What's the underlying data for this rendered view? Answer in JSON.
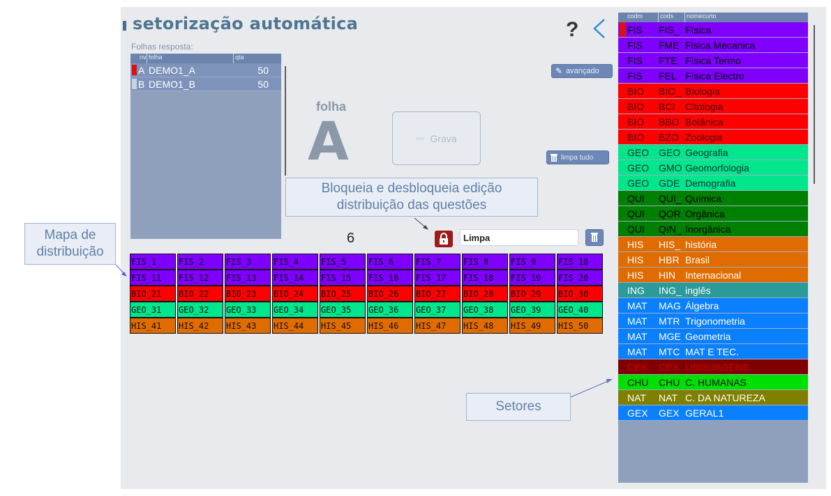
{
  "header": {
    "title": "setorização automática",
    "help_label": "?"
  },
  "folhas": {
    "label": "Folhas resposta:",
    "columns": [
      "nv",
      "folha",
      "qta"
    ],
    "rows": [
      {
        "nv": "A",
        "folha": "DEMO1_A",
        "qta": "50",
        "selected": true
      },
      {
        "nv": "B",
        "folha": "DEMO1_B",
        "qta": "50",
        "selected": false
      }
    ]
  },
  "folha_display": {
    "label": "folha",
    "letter": "A"
  },
  "actions": {
    "grava_label": "Grava",
    "avancado_label": "avançado",
    "limpa_tudo_label": "limpa tudo"
  },
  "callouts": {
    "bloqueia": "Bloqueia e desbloqueia edição distribuição das questões",
    "mapa": "Mapa de distribuição",
    "setores": "Setores"
  },
  "toolbar": {
    "count": "6",
    "limpa_value": "Limpa"
  },
  "colors": {
    "FIS": "#8000ff",
    "BIO": "#ff0000",
    "GEO": "#00e68c",
    "QUI": "#008000",
    "HIS": "#e06c00",
    "ING": "#2a9a9a",
    "MAT": "#0a80ff",
    "CEX": "#800000",
    "CHU": "#00e000",
    "NAT": "#808000",
    "GEX": "#0a80ff"
  },
  "distribution": [
    [
      "FIS_1",
      "FIS_2",
      "FIS_3",
      "FIS_4",
      "FIS_5",
      "FIS_6",
      "FIS_7",
      "FIS_8",
      "FIS_9",
      "FIS_10"
    ],
    [
      "FIS_11",
      "FIS_12",
      "FIS_13",
      "FIS_14",
      "FIS_15",
      "FIS_16",
      "FIS_17",
      "FIS_18",
      "FIS_19",
      "FIS_20"
    ],
    [
      "BIO_21",
      "BIO_22",
      "BIO_23",
      "BIO_24",
      "BIO_25",
      "BIO_26",
      "BIO_27",
      "BIO_28",
      "BIO_29",
      "BIO_30"
    ],
    [
      "GEO_31",
      "GEO_32",
      "GEO_33",
      "GEO_34",
      "GEO_35",
      "GEO_36",
      "GEO_37",
      "GEO_38",
      "GEO_39",
      "GEO_40"
    ],
    [
      "HIS_41",
      "HIS_42",
      "HIS_43",
      "HIS_44",
      "HIS_45",
      "HIS_46",
      "HIS_47",
      "HIS_48",
      "HIS_49",
      "HIS_50"
    ]
  ],
  "setores": {
    "columns": [
      "codm",
      "cods",
      "nomecurto"
    ],
    "rows": [
      {
        "codm": "FIS",
        "cods": "FIS_",
        "nome": "Física",
        "selected": true
      },
      {
        "codm": "FIS",
        "cods": "FME",
        "nome": "Fisica Mecanica"
      },
      {
        "codm": "FIS",
        "cods": "FTE",
        "nome": "Física Termo"
      },
      {
        "codm": "FIS",
        "cods": "FEL",
        "nome": "Física Electro"
      },
      {
        "codm": "BIO",
        "cods": "BIO_",
        "nome": "Biologia"
      },
      {
        "codm": "BIO",
        "cods": "BCI",
        "nome": "Citologia"
      },
      {
        "codm": "BIO",
        "cods": "BBO",
        "nome": "Botânica"
      },
      {
        "codm": "BIO",
        "cods": "BZO",
        "nome": "Zoologia"
      },
      {
        "codm": "GEO",
        "cods": "GEO",
        "nome": "Geografia"
      },
      {
        "codm": "GEO",
        "cods": "GMO",
        "nome": "Geomorfologia"
      },
      {
        "codm": "GEO",
        "cods": "GDE",
        "nome": "Demografia"
      },
      {
        "codm": "QUI",
        "cods": "QUI_",
        "nome": "Química"
      },
      {
        "codm": "QUI",
        "cods": "QOR",
        "nome": "Orgânica"
      },
      {
        "codm": "QUI",
        "cods": "QIN_",
        "nome": "Inorgânica"
      },
      {
        "codm": "HIS",
        "cods": "HIS_",
        "nome": "história"
      },
      {
        "codm": "HIS",
        "cods": "HBR",
        "nome": "Brasil"
      },
      {
        "codm": "HIS",
        "cods": "HIN",
        "nome": "Internacional"
      },
      {
        "codm": "ING",
        "cods": "ING_",
        "nome": "inglês"
      },
      {
        "codm": "MAT",
        "cods": "MAG",
        "nome": "Álgebra"
      },
      {
        "codm": "MAT",
        "cods": "MTR",
        "nome": "Trigonometria"
      },
      {
        "codm": "MAT",
        "cods": "MGE",
        "nome": "Geometria"
      },
      {
        "codm": "MAT",
        "cods": "MTC",
        "nome": "MAT E TEC."
      },
      {
        "codm": "CEX",
        "cods": "CEX",
        "nome": "LINGUAGENS"
      },
      {
        "codm": "CHU",
        "cods": "CHU",
        "nome": "C. HUMANAS"
      },
      {
        "codm": "NAT",
        "cods": "NAT",
        "nome": "C. DA NATUREZA"
      },
      {
        "codm": "GEX",
        "cods": "GEX",
        "nome": "GERAL1"
      }
    ]
  }
}
